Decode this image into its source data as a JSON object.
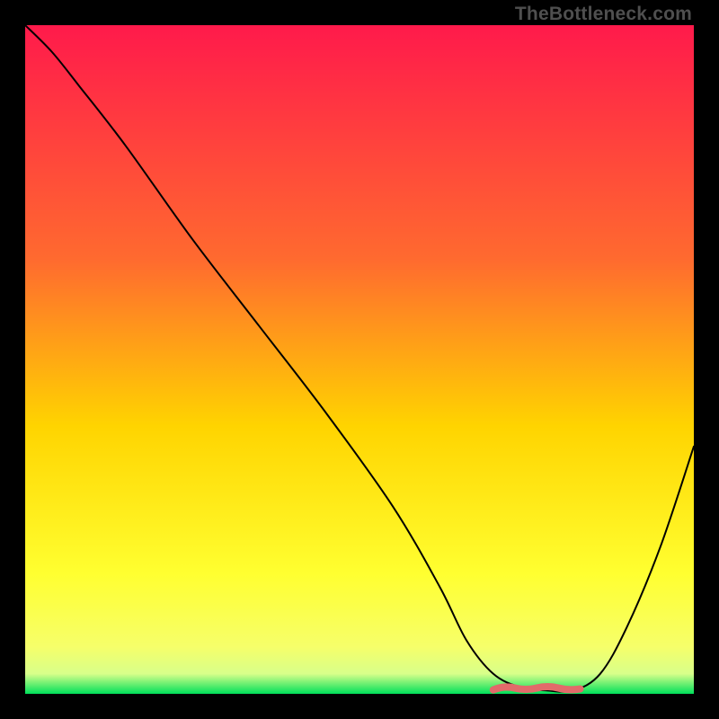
{
  "watermark": "TheBottleneck.com",
  "colors": {
    "grad_top": "#ff1a4b",
    "grad_mid1": "#ff6a2f",
    "grad_mid2": "#ffd400",
    "grad_low": "#f6ff6a",
    "grad_bottom": "#00e05a",
    "curve": "#000000",
    "valley": "#e26a6a",
    "frame": "#000000"
  },
  "chart_data": {
    "type": "line",
    "title": "",
    "xlabel": "",
    "ylabel": "",
    "xlim": [
      0,
      100
    ],
    "ylim": [
      0,
      100
    ],
    "grid": false,
    "legend": false,
    "series": [
      {
        "name": "bottleneck-curve",
        "x": [
          0,
          4,
          8,
          15,
          25,
          35,
          45,
          55,
          62,
          66,
          70,
          74,
          78,
          82,
          86,
          90,
          95,
          100
        ],
        "y": [
          100,
          96,
          91,
          82,
          68,
          55,
          42,
          28,
          16,
          8,
          3,
          1,
          0.5,
          0.5,
          3,
          10,
          22,
          37
        ]
      }
    ],
    "valley_segment": {
      "x_start": 70,
      "x_end": 83,
      "y": 1
    },
    "gradient_stops": [
      {
        "offset": 0.0,
        "color": "#ff1a4b"
      },
      {
        "offset": 0.35,
        "color": "#ff6a2f"
      },
      {
        "offset": 0.6,
        "color": "#ffd400"
      },
      {
        "offset": 0.82,
        "color": "#ffff30"
      },
      {
        "offset": 0.93,
        "color": "#f6ff6a"
      },
      {
        "offset": 0.97,
        "color": "#d8ff8a"
      },
      {
        "offset": 1.0,
        "color": "#00e05a"
      }
    ]
  }
}
